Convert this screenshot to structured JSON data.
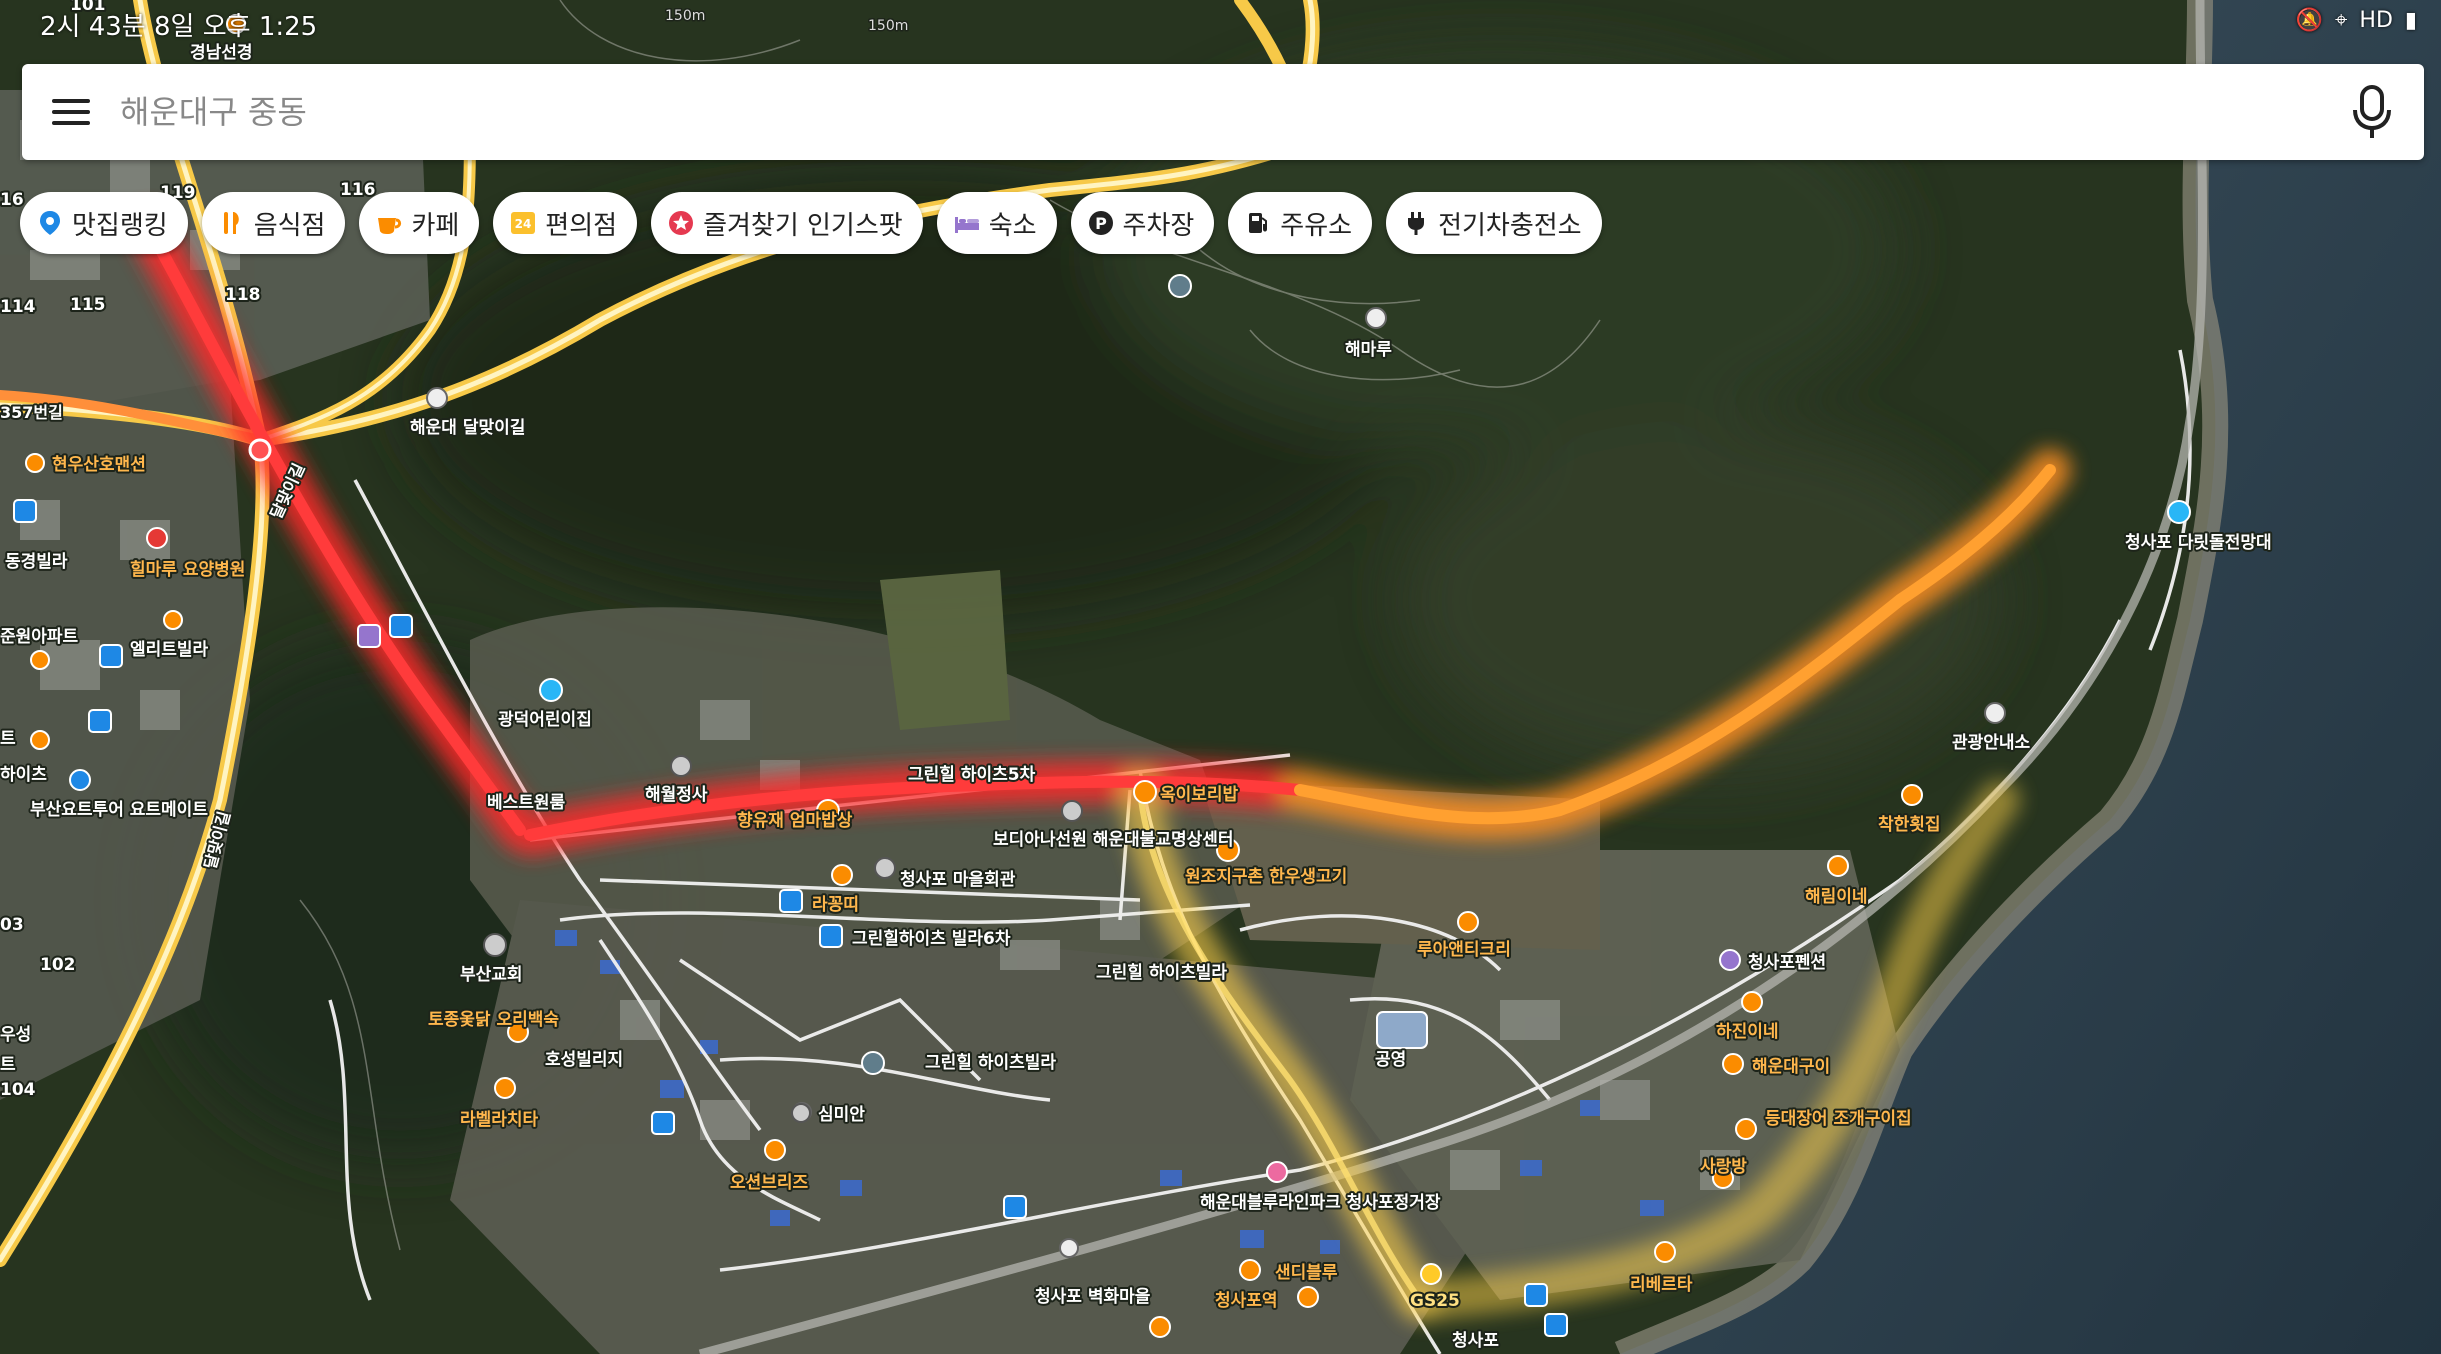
{
  "status_bar": {
    "time": "2시 43분 8일 오후 1:25",
    "icons": [
      "mute-icon",
      "location-icon",
      "wifi-icon",
      "signal-icon"
    ],
    "network_label": "HD"
  },
  "search": {
    "placeholder": "해운대구 중동",
    "value": ""
  },
  "chips": [
    {
      "label": "맛집랭킹",
      "icon": "restaurant-ranking-icon",
      "color": "#1e88e5"
    },
    {
      "label": "음식점",
      "icon": "fork-knife-icon",
      "color": "#fb8c00"
    },
    {
      "label": "카페",
      "icon": "coffee-cup-icon",
      "color": "#fb8c00"
    },
    {
      "label": "편의점",
      "icon": "convenience-24-icon",
      "color": "#fbc02d"
    },
    {
      "label": "즐겨찾기 인기스팟",
      "icon": "star-icon",
      "color": "#e53950"
    },
    {
      "label": "숙소",
      "icon": "bed-icon",
      "color": "#9575cd"
    },
    {
      "label": "주차장",
      "icon": "parking-icon",
      "color": "#222222"
    },
    {
      "label": "주유소",
      "icon": "gas-pump-icon",
      "color": "#222222"
    },
    {
      "label": "전기차충전소",
      "icon": "ev-plug-icon",
      "color": "#222222"
    }
  ],
  "map": {
    "contour_labels": [
      "150m",
      "150m"
    ],
    "road_labels": [
      "달맞이길",
      "달맞이길",
      "357번길"
    ],
    "places": [
      {
        "name": "경남선경",
        "type": "orange"
      },
      {
        "name": "해운대 달맞이길",
        "type": "white"
      },
      {
        "name": "현우산호맨션",
        "type": "orange"
      },
      {
        "name": "동경빌라",
        "type": "white"
      },
      {
        "name": "힐마루 요양병원",
        "type": "orange"
      },
      {
        "name": "준원아파트",
        "type": "white"
      },
      {
        "name": "엘리트빌라",
        "type": "white"
      },
      {
        "name": "하이츠",
        "type": "white"
      },
      {
        "name": "부산요트투어 요트메이트",
        "type": "white"
      },
      {
        "name": "해마루",
        "type": "white"
      },
      {
        "name": "광덕어린이집",
        "type": "white"
      },
      {
        "name": "해월정사",
        "type": "white"
      },
      {
        "name": "베스트원룸",
        "type": "white"
      },
      {
        "name": "향유재 엄마밥상",
        "type": "orange"
      },
      {
        "name": "그린힐 하이츠5차",
        "type": "white"
      },
      {
        "name": "보디아나선원 해운대불교명상센터",
        "type": "white"
      },
      {
        "name": "옥이보리밥",
        "type": "orange"
      },
      {
        "name": "청사포 마을회관",
        "type": "white"
      },
      {
        "name": "라꽁띠",
        "type": "orange"
      },
      {
        "name": "원조지구촌 한우생고기",
        "type": "orange"
      },
      {
        "name": "그린힐하이츠 빌라6차",
        "type": "white"
      },
      {
        "name": "부산교회",
        "type": "white"
      },
      {
        "name": "그린힐 하이츠빌라",
        "type": "white"
      },
      {
        "name": "루아앤티크리",
        "type": "orange"
      },
      {
        "name": "토종옻닭 오리백숙",
        "type": "orange"
      },
      {
        "name": "호성빌리지",
        "type": "white"
      },
      {
        "name": "그린힐 하이츠빌라",
        "type": "white"
      },
      {
        "name": "공영",
        "type": "white"
      },
      {
        "name": "라벨라치타",
        "type": "orange"
      },
      {
        "name": "심미안",
        "type": "white"
      },
      {
        "name": "오션브리즈",
        "type": "orange"
      },
      {
        "name": "해운대블루라인파크 청사포정거장",
        "type": "white"
      },
      {
        "name": "청사포 벽화마을",
        "type": "white"
      },
      {
        "name": "샌디블루",
        "type": "orange"
      },
      {
        "name": "청사포역",
        "type": "orange"
      },
      {
        "name": "GS25",
        "type": "yellow"
      },
      {
        "name": "청사포",
        "type": "white"
      },
      {
        "name": "관광안내소",
        "type": "white"
      },
      {
        "name": "착한횟집",
        "type": "orange"
      },
      {
        "name": "청사포 다릿돌전망대",
        "type": "white"
      },
      {
        "name": "해림이네",
        "type": "orange"
      },
      {
        "name": "청사포펜션",
        "type": "white"
      },
      {
        "name": "하진이네",
        "type": "orange"
      },
      {
        "name": "해운대구이",
        "type": "orange"
      },
      {
        "name": "등대장어 조개구이집",
        "type": "orange"
      },
      {
        "name": "사랑방",
        "type": "orange"
      },
      {
        "name": "리베르타",
        "type": "orange"
      },
      {
        "name": "101",
        "type": "white"
      },
      {
        "name": "116",
        "type": "white"
      },
      {
        "name": "119",
        "type": "white"
      },
      {
        "name": "115",
        "type": "white"
      },
      {
        "name": "118",
        "type": "white"
      },
      {
        "name": "114",
        "type": "white"
      },
      {
        "name": "16",
        "type": "white"
      },
      {
        "name": "102",
        "type": "white"
      },
      {
        "name": "104",
        "type": "white"
      },
      {
        "name": "03",
        "type": "white"
      },
      {
        "name": "트",
        "type": "white"
      },
      {
        "name": "우성",
        "type": "white"
      },
      {
        "name": "트",
        "type": "white"
      }
    ],
    "colors": {
      "traffic_red": "#ff2a2a",
      "traffic_orange": "#ff8f1f",
      "traffic_yellow": "#ffd54a",
      "forest": "#253220",
      "sea": "#2b3f50"
    }
  }
}
